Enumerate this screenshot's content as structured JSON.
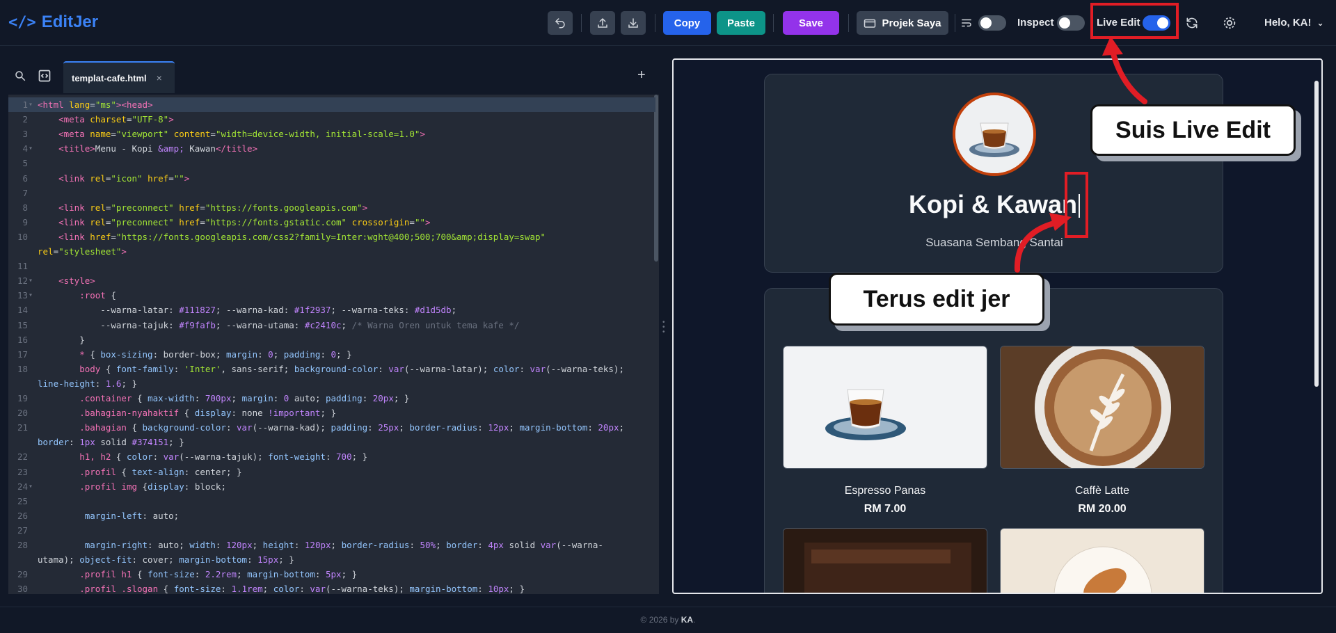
{
  "app": {
    "logo_glyph": "</>",
    "name": "EditJer"
  },
  "toolbar": {
    "copy_label": "Copy",
    "paste_label": "Paste",
    "save_label": "Save",
    "project_label": "Projek Saya",
    "inspect_label": "Inspect",
    "live_edit_label": "Live Edit",
    "greeting": "Helo, KA!"
  },
  "colors": {
    "accent": "#3b82f6",
    "copy": "#2563eb",
    "paste": "#0d9488",
    "save": "#9333ea",
    "annotation": "#e11d25",
    "cafe_primary": "#c2410c"
  },
  "toggles": {
    "wrap_on": false,
    "inspect_on": false,
    "live_edit_on": true
  },
  "editor": {
    "tab_name": "templat-cafe.html",
    "tab_close": "×",
    "add_tab": "+",
    "lines": [
      {
        "n": "1",
        "fold": "▾",
        "html": "<span class='tg'>&lt;html</span> <span class='at'>lang</span>=<span class='st'>\"ms\"</span><span class='tg'>&gt;&lt;head&gt;</span>",
        "hl": true
      },
      {
        "n": "2",
        "html": "    <span class='tg'>&lt;meta</span> <span class='at'>charset</span>=<span class='st'>\"UTF-8\"</span><span class='tg'>&gt;</span>"
      },
      {
        "n": "3",
        "html": "    <span class='tg'>&lt;meta</span> <span class='at'>name</span>=<span class='st'>\"viewport\"</span> <span class='at'>content</span>=<span class='st'>\"width=device-width, initial-scale=1.0\"</span><span class='tg'>&gt;</span>"
      },
      {
        "n": "4",
        "fold": "▾",
        "html": "    <span class='tg'>&lt;title&gt;</span>Menu - Kopi <span class='vl'>&amp;amp;</span> Kawan<span class='tg'>&lt;/title&gt;</span>"
      },
      {
        "n": "5",
        "html": ""
      },
      {
        "n": "6",
        "html": "    <span class='tg'>&lt;link</span> <span class='at'>rel</span>=<span class='st'>\"icon\"</span> <span class='at'>href</span>=<span class='st'>\"\"</span><span class='tg'>&gt;</span>"
      },
      {
        "n": "7",
        "html": ""
      },
      {
        "n": "8",
        "html": "    <span class='tg'>&lt;link</span> <span class='at'>rel</span>=<span class='st'>\"preconnect\"</span> <span class='at'>href</span>=<span class='st'>\"https://fonts.googleapis.com\"</span><span class='tg'>&gt;</span>"
      },
      {
        "n": "9",
        "html": "    <span class='tg'>&lt;link</span> <span class='at'>rel</span>=<span class='st'>\"preconnect\"</span> <span class='at'>href</span>=<span class='st'>\"https://fonts.gstatic.com\"</span> <span class='at'>crossorigin</span>=<span class='st'>\"\"</span><span class='tg'>&gt;</span>"
      },
      {
        "n": "10",
        "html": "    <span class='tg'>&lt;link</span> <span class='at'>href</span>=<span class='st'>\"https://fonts.googleapis.com/css2?family=Inter:wght@400;500;700&amp;amp;display=swap\"</span>"
      },
      {
        "n": "",
        "html": "<span class='at'>rel</span>=<span class='st'>\"stylesheet\"</span><span class='tg'>&gt;</span>"
      },
      {
        "n": "11",
        "html": ""
      },
      {
        "n": "12",
        "fold": "▾",
        "html": "    <span class='tg'>&lt;style&gt;</span>"
      },
      {
        "n": "13",
        "fold": "▾",
        "html": "        <span class='pr'>:root</span> {"
      },
      {
        "n": "14",
        "html": "            --warna-latar: <span class='vl'>#111827</span>; --warna-kad: <span class='vl'>#1f2937</span>; --warna-teks: <span class='vl'>#d1d5db</span>;"
      },
      {
        "n": "15",
        "html": "            --warna-tajuk: <span class='vl'>#f9fafb</span>; --warna-utama: <span class='vl'>#c2410c</span>; <span class='cm'>/* Warna Oren untuk tema kafe */</span>"
      },
      {
        "n": "16",
        "html": "        }"
      },
      {
        "n": "17",
        "html": "        <span class='pr'>*</span> { <span class='sl'>box-sizing</span>: border-box; <span class='sl'>margin</span>: <span class='vl'>0</span>; <span class='sl'>padding</span>: <span class='vl'>0</span>; }"
      },
      {
        "n": "18",
        "html": "        <span class='pr'>body</span> { <span class='sl'>font-family</span>: <span class='st'>'Inter'</span>, sans-serif; <span class='sl'>background-color</span>: <span class='vl'>var</span>(--warna-latar); <span class='sl'>color</span>: <span class='vl'>var</span>(--warna-teks);"
      },
      {
        "n": "",
        "html": "<span class='sl'>line-height</span>: <span class='vl'>1.6</span>; }"
      },
      {
        "n": "19",
        "html": "        <span class='pr'>.container</span> { <span class='sl'>max-width</span>: <span class='vl'>700px</span>; <span class='sl'>margin</span>: <span class='vl'>0</span> auto; <span class='sl'>padding</span>: <span class='vl'>20px</span>; }"
      },
      {
        "n": "20",
        "html": "        <span class='pr'>.bahagian-nyahaktif</span> { <span class='sl'>display</span>: none <span class='vl'>!important</span>; }"
      },
      {
        "n": "21",
        "html": "        <span class='pr'>.bahagian</span> { <span class='sl'>background-color</span>: <span class='vl'>var</span>(--warna-kad); <span class='sl'>padding</span>: <span class='vl'>25px</span>; <span class='sl'>border-radius</span>: <span class='vl'>12px</span>; <span class='sl'>margin-bottom</span>: <span class='vl'>20px</span>;"
      },
      {
        "n": "",
        "html": "<span class='sl'>border</span>: <span class='vl'>1px</span> solid <span class='vl'>#374151</span>; }"
      },
      {
        "n": "22",
        "html": "        <span class='pr'>h1, h2</span> { <span class='sl'>color</span>: <span class='vl'>var</span>(--warna-tajuk); <span class='sl'>font-weight</span>: <span class='vl'>700</span>; }"
      },
      {
        "n": "23",
        "html": "        <span class='pr'>.profil</span> { <span class='sl'>text-align</span>: center; }"
      },
      {
        "n": "24",
        "fold": "▾",
        "html": "        <span class='pr'>.profil img</span> {<span class='sl'>display</span>: block;"
      },
      {
        "n": "25",
        "html": ""
      },
      {
        "n": "26",
        "html": "         <span class='sl'>margin-left</span>: auto;"
      },
      {
        "n": "27",
        "html": ""
      },
      {
        "n": "28",
        "html": "         <span class='sl'>margin-right</span>: auto; <span class='sl'>width</span>: <span class='vl'>120px</span>; <span class='sl'>height</span>: <span class='vl'>120px</span>; <span class='sl'>border-radius</span>: <span class='vl'>50%</span>; <span class='sl'>border</span>: <span class='vl'>4px</span> solid <span class='vl'>var</span>(--warna-"
      },
      {
        "n": "",
        "html": "utama); <span class='sl'>object-fit</span>: cover; <span class='sl'>margin-bottom</span>: <span class='vl'>15px</span>; }"
      },
      {
        "n": "29",
        "html": "        <span class='pr'>.profil h1</span> { <span class='sl'>font-size</span>: <span class='vl'>2.2rem</span>; <span class='sl'>margin-bottom</span>: <span class='vl'>5px</span>; }"
      },
      {
        "n": "30",
        "html": "        <span class='pr'>.profil .slogan</span> { <span class='sl'>font-size</span>: <span class='vl'>1.1rem</span>; <span class='sl'>color</span>: <span class='vl'>var</span>(--warna-teks); <span class='sl'>margin-bottom</span>: <span class='vl'>10px</span>; }"
      }
    ]
  },
  "preview": {
    "title": "Kopi & Kawan",
    "slogan": "Suasana Sembang Santai",
    "items": [
      {
        "name": "Espresso Panas",
        "price": "RM 7.00"
      },
      {
        "name": "Caffè Latte",
        "price": "RM 20.00"
      }
    ]
  },
  "annotations": {
    "live_edit_callout": "Suis Live Edit",
    "edit_callout": "Terus edit jer"
  },
  "footer": {
    "prefix": "© 2026 by ",
    "author": "KA",
    "suffix": "."
  }
}
